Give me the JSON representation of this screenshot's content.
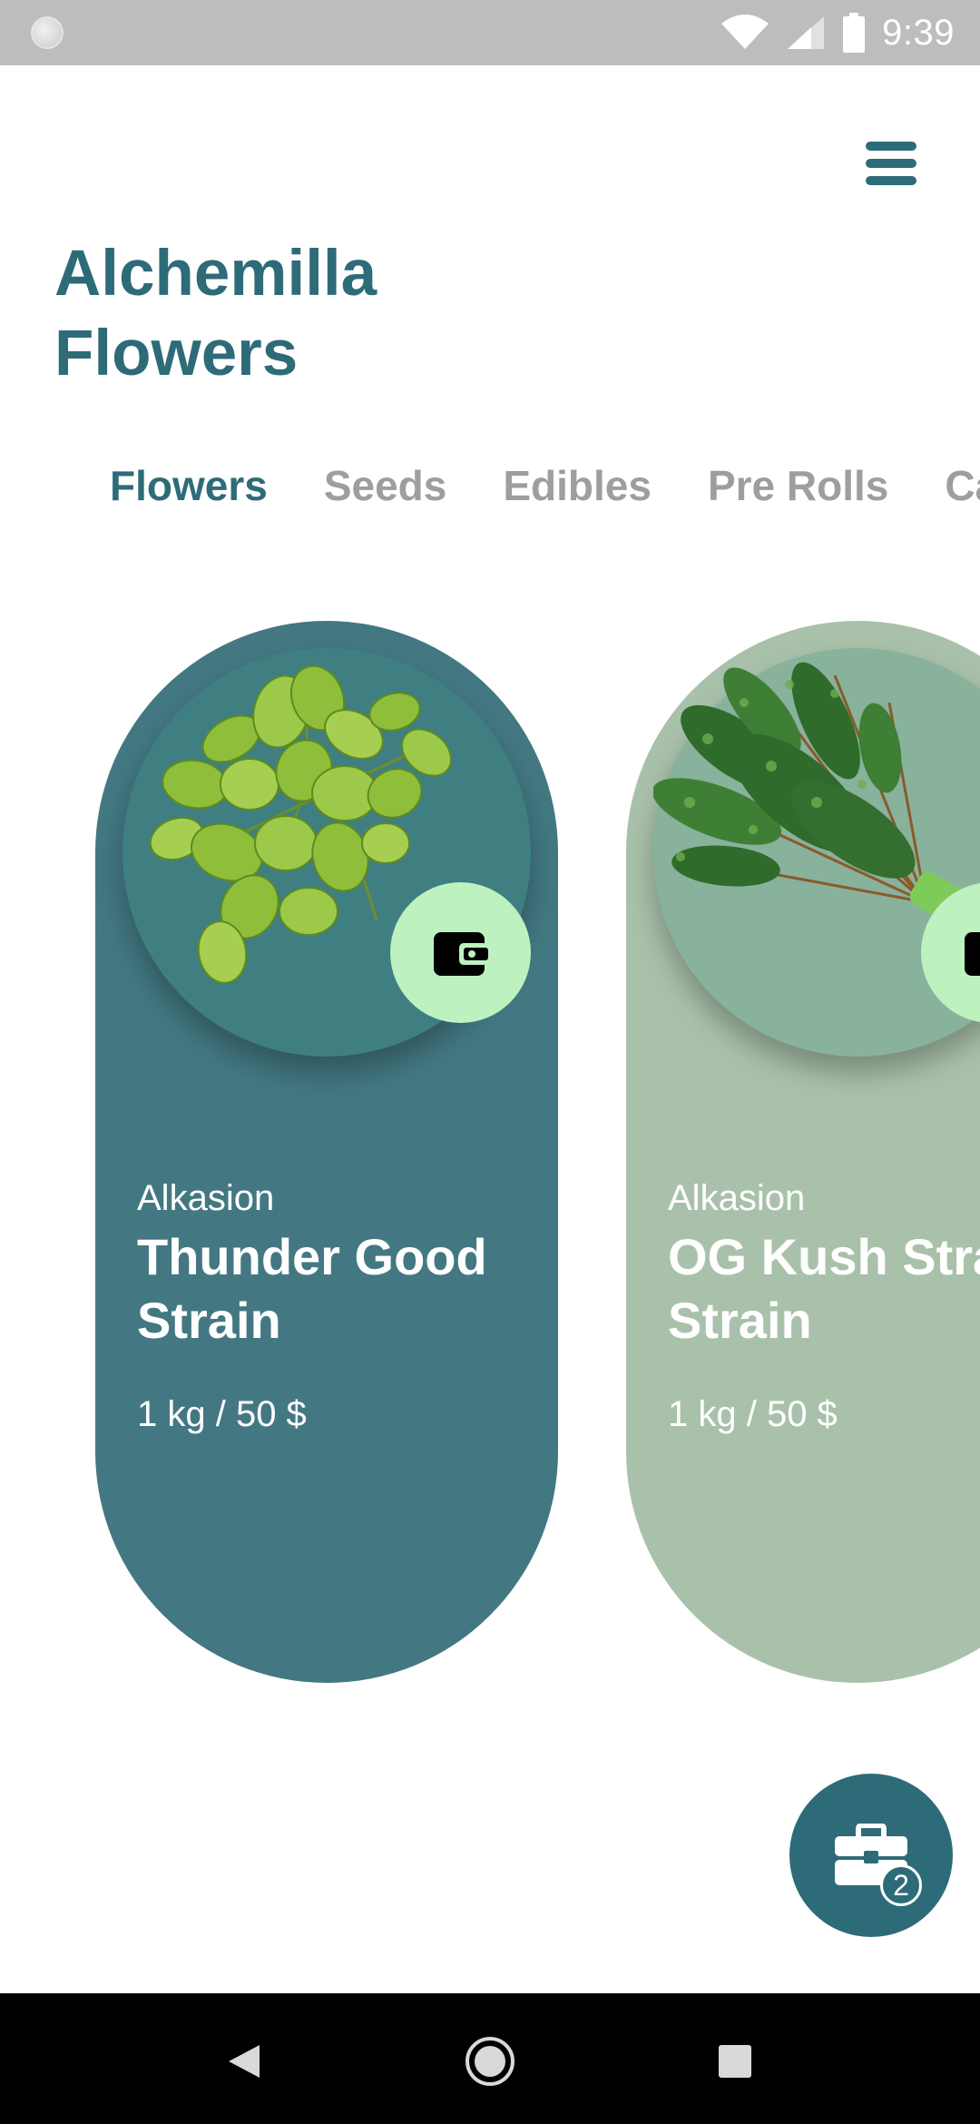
{
  "status_bar": {
    "time": "9:39",
    "icons": [
      "notification-dot",
      "wifi-icon",
      "signal-icon",
      "battery-icon"
    ]
  },
  "header": {
    "title_line1": "Alchemilla",
    "title_line2": "Flowers",
    "menu_icon": "hamburger-menu-icon"
  },
  "tabs": [
    {
      "label": "Flowers",
      "active": true
    },
    {
      "label": "Seeds",
      "active": false
    },
    {
      "label": "Edibles",
      "active": false
    },
    {
      "label": "Pre Rolls",
      "active": false
    },
    {
      "label": "Ca",
      "active": false
    }
  ],
  "products": [
    {
      "brand": "Alkasion",
      "name": "Thunder Good Strain",
      "price": "1 kg / 50 $",
      "image": "leafy-herb-image",
      "action_icon": "wallet-icon",
      "card_color": "#437882"
    },
    {
      "brand": "Alkasion",
      "name": "OG Kush Strain Strain",
      "price": "1 kg / 50 $",
      "image": "thyme-bundle-image",
      "action_icon": "wallet-icon",
      "card_color": "#a9c1aa"
    }
  ],
  "cart": {
    "icon": "toolbox-icon",
    "count": "2"
  },
  "nav_bar": {
    "buttons": [
      "back-icon",
      "home-icon",
      "recents-icon"
    ]
  },
  "colors": {
    "accent": "#2e6b78",
    "inactive_tab": "#9e9e9e",
    "action_button": "#bdf1c0"
  }
}
